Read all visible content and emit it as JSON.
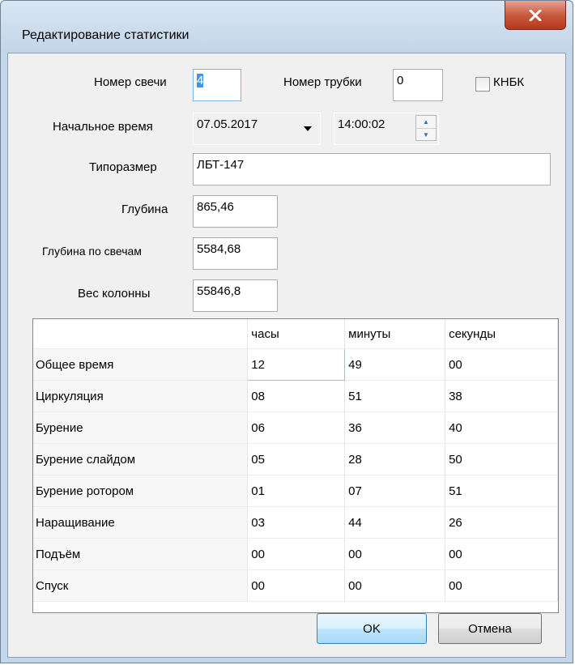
{
  "window": {
    "title": "Редактирование статистики",
    "close_glyph": "X"
  },
  "fields": {
    "candle_number": {
      "label": "Номер свечи",
      "value": "4"
    },
    "tube_number": {
      "label": "Номер трубки",
      "value": "0"
    },
    "knbk": {
      "label": "КНБК",
      "checked": false
    },
    "start_time": {
      "label": "Начальное время",
      "date": "07.05.2017",
      "time": "14:00:02"
    },
    "size_type": {
      "label": "Типоразмер",
      "value": "ЛБТ-147"
    },
    "depth": {
      "label": "Глубина",
      "value": "865,46"
    },
    "depth_by_candles": {
      "label": "Глубина по свечам",
      "value": "5584,68"
    },
    "column_weight": {
      "label": "Вес колонны",
      "value": "55846,8"
    }
  },
  "table": {
    "columns": [
      "",
      "часы",
      "минуты",
      "секунды"
    ],
    "rows": [
      [
        "Общее время",
        "12",
        "49",
        "00"
      ],
      [
        "Циркуляция",
        "08",
        "51",
        "38"
      ],
      [
        "Бурение",
        "06",
        "36",
        "40"
      ],
      [
        "Бурение слайдом",
        "05",
        "28",
        "50"
      ],
      [
        "Бурение ротором",
        "01",
        "07",
        "51"
      ],
      [
        "Наращивание",
        "03",
        "44",
        "26"
      ],
      [
        "Подъём",
        "00",
        "00",
        "00"
      ],
      [
        "Спуск",
        "00",
        "00",
        "00"
      ]
    ]
  },
  "buttons": {
    "ok": "OK",
    "cancel": "Отмена"
  },
  "icons": {
    "dropdown": "triangle-down-icon",
    "spin_up": "arrow-up-icon",
    "spin_down": "arrow-down-icon"
  },
  "colors": {
    "titlebar": "#c4d7ea",
    "close": "#c85a3e",
    "focus": "#7eb4ea"
  }
}
